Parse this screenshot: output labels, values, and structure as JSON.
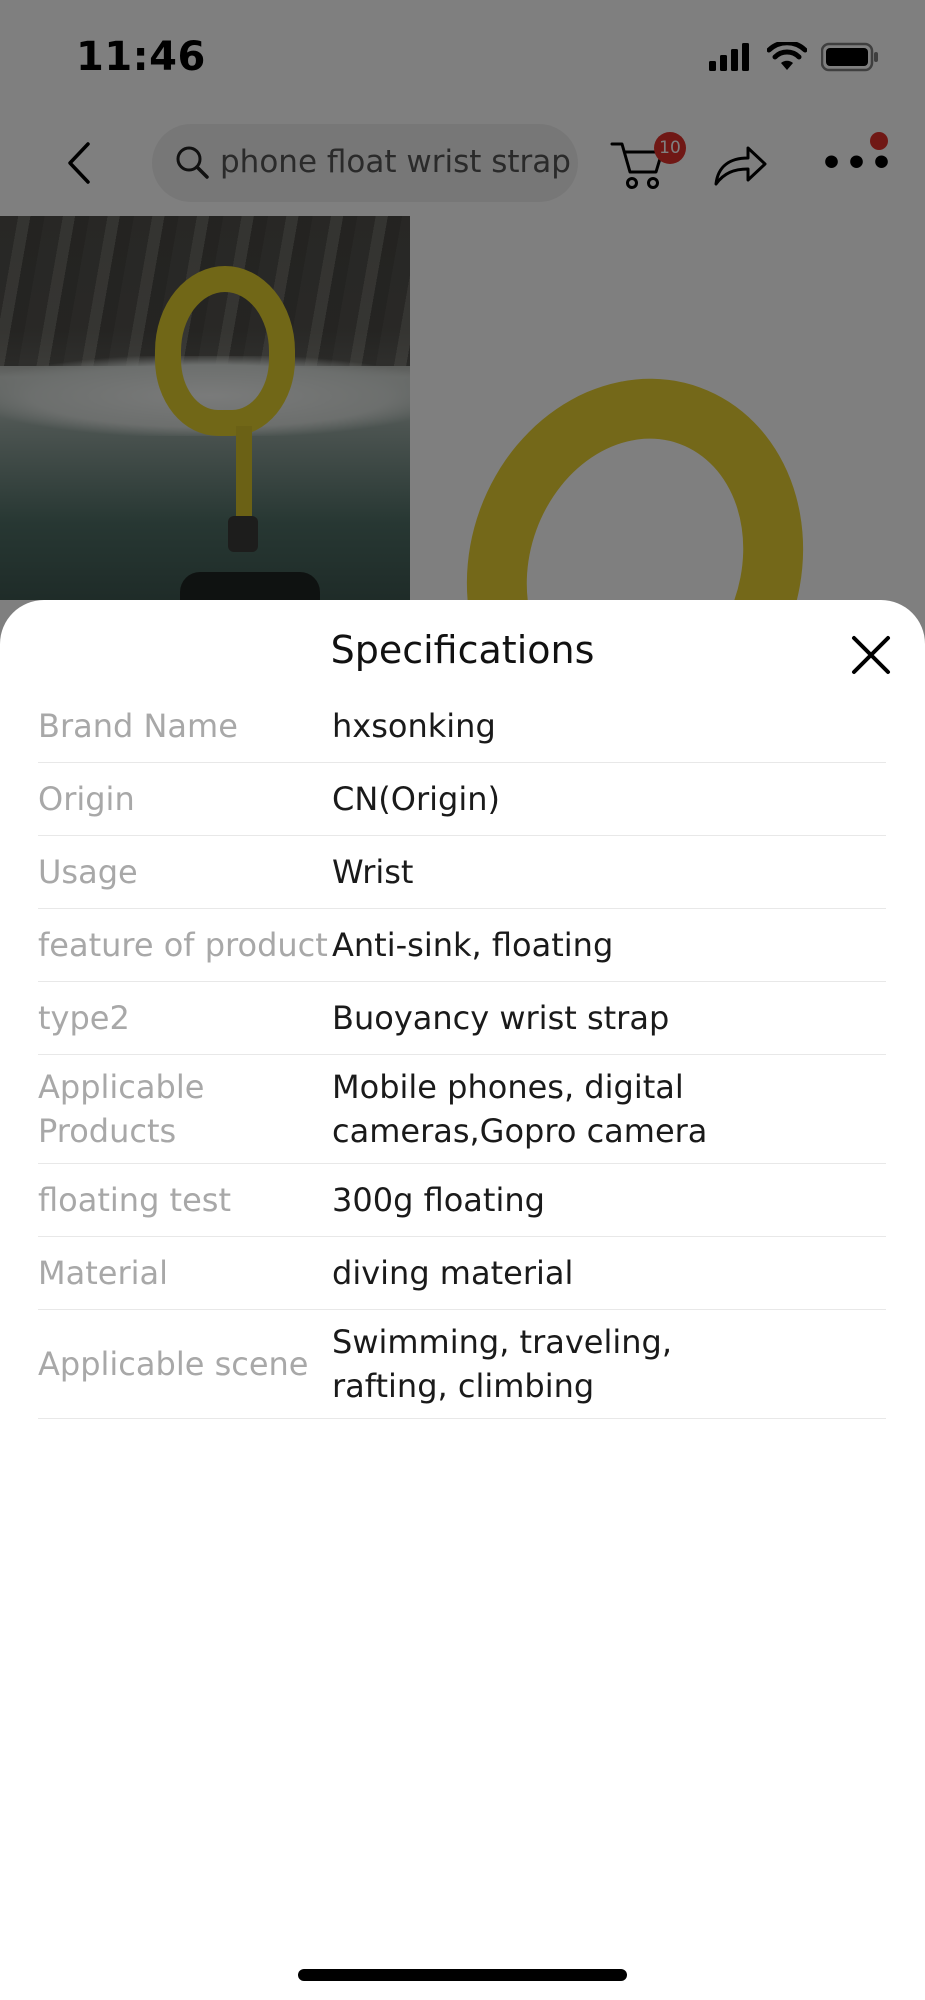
{
  "status_bar": {
    "time": "11:46"
  },
  "header": {
    "search_text": "phone float wrist strap",
    "cart_count": "10"
  },
  "sheet": {
    "title": "Specifications",
    "specs": [
      {
        "label": "Brand Name",
        "value": "hxsonking"
      },
      {
        "label": "Origin",
        "value": "CN(Origin)"
      },
      {
        "label": "Usage",
        "value": "Wrist"
      },
      {
        "label": "feature of product",
        "value": "Anti-sink, floating"
      },
      {
        "label": "type2",
        "value": "Buoyancy wrist strap"
      },
      {
        "label": "Applicable\nProducts",
        "value": "Mobile phones, digital\ncameras,Gopro camera"
      },
      {
        "label": "floating test",
        "value": "300g floating"
      },
      {
        "label": "Material",
        "value": "diving material"
      },
      {
        "label": "Applicable scene",
        "value": "Swimming, traveling,\nrafting, climbing"
      }
    ]
  },
  "colors": {
    "badge": "#e0312b",
    "strap_yellow": "#e3cf2e"
  }
}
